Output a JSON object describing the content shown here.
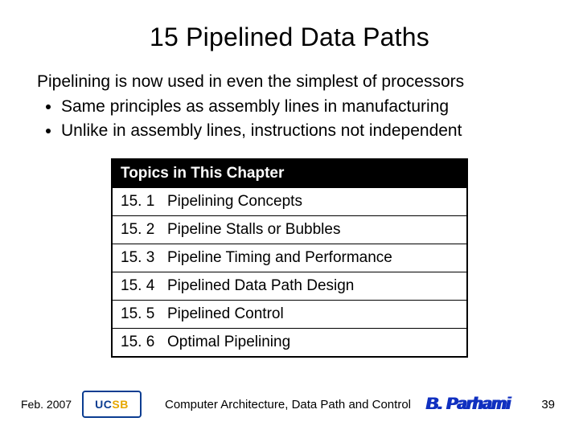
{
  "title": "15   Pipelined Data Paths",
  "intro": {
    "lead": "Pipelining is now used in even the simplest of processors",
    "bullets": [
      "Same principles as assembly lines in manufacturing",
      "Unlike in assembly lines, instructions not independent"
    ]
  },
  "topics": {
    "header": "Topics in This Chapter",
    "rows": [
      {
        "num": "15. 1",
        "title": "Pipelining Concepts"
      },
      {
        "num": "15. 2",
        "title": "Pipeline Stalls or Bubbles"
      },
      {
        "num": "15. 3",
        "title": "Pipeline Timing and Performance"
      },
      {
        "num": "15. 4",
        "title": "Pipelined Data Path Design"
      },
      {
        "num": "15. 5",
        "title": "Pipelined Control"
      },
      {
        "num": "15. 6",
        "title": "Optimal Pipelining"
      }
    ]
  },
  "footer": {
    "date": "Feb. 2007",
    "logo_text_1": "UC",
    "logo_text_2": "SB",
    "center": "Computer Architecture, Data Path and Control",
    "author": "B. Parhami",
    "page": "39"
  }
}
